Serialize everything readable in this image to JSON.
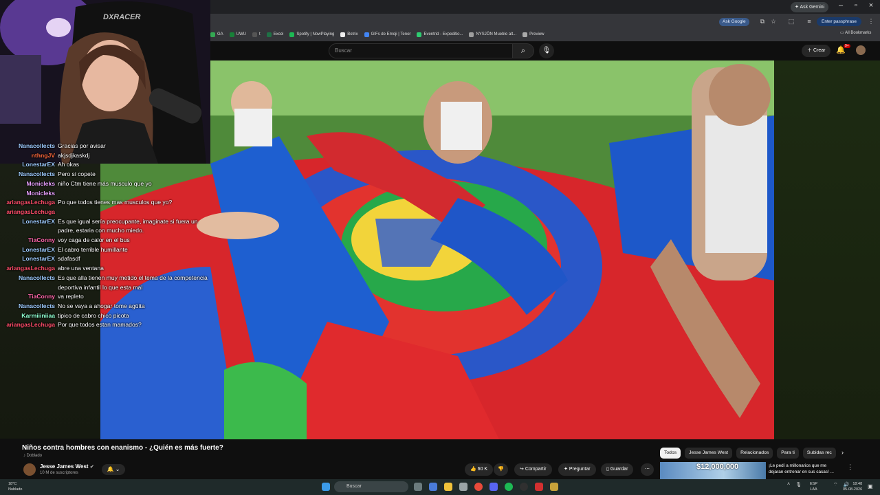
{
  "browser": {
    "gemini_label": "Ask Gemini",
    "ask_google_label": "Ask Google",
    "passphrase_label": "Enter passphrase",
    "all_bookmarks_label": "All Bookmarks",
    "bookmarks": [
      {
        "label": "GA",
        "color": "#34a853"
      },
      {
        "label": "UWU",
        "color": "#188038"
      },
      {
        "label": "t",
        "color": "#555555"
      },
      {
        "label": "Excel",
        "color": "#1e7145"
      },
      {
        "label": "Spotify | NowPlaying",
        "color": "#1db954"
      },
      {
        "label": "Botrix",
        "color": "#eeeeee"
      },
      {
        "label": "GIFs de Emoji | Tenor",
        "color": "#4285f4"
      },
      {
        "label": "Eventrid - Expeditio...",
        "color": "#2ecc71"
      },
      {
        "label": "NYSJÖN Mueble alt...",
        "color": "#9e9e9e"
      },
      {
        "label": "Preview",
        "color": "#aaaaaa"
      }
    ]
  },
  "youtube": {
    "search_placeholder": "Buscar",
    "create_label": "Crear",
    "notification_count": "9+"
  },
  "webcam": {
    "chair_brand": "DXRACER"
  },
  "chat": [
    {
      "user": "Nanacollects",
      "color": "#9ecbff",
      "text": "Gracias por avisar"
    },
    {
      "user": "nthngJV",
      "color": "#ff6a3d",
      "text": "akjsdjkaskdj"
    },
    {
      "user": "LonestarEX",
      "color": "#9ecbff",
      "text": "Ah okas"
    },
    {
      "user": "Nanacollects",
      "color": "#9ecbff",
      "text": "Pero si copete"
    },
    {
      "user": "Monicleks",
      "color": "#e8a0ff",
      "text": "niño Ctm tiene más musculo que yo"
    },
    {
      "user": "Monicleks",
      "color": "#e8a0ff",
      "text": ""
    },
    {
      "user": "ariangasLechuga",
      "color": "#ff4d6a",
      "text": "Po que todos tienes mas musculos que yo?"
    },
    {
      "user": "ariangasLechuga",
      "color": "#ff4d6a",
      "text": ""
    },
    {
      "user": "LonestarEX",
      "color": "#9ecbff",
      "text": "Es que igual sería preocupante, imaginate si fuera un padre, estaria con mucho miedo."
    },
    {
      "user": "TiaConny",
      "color": "#ff66aa",
      "text": "voy caga de calor en el bus"
    },
    {
      "user": "LonestarEX",
      "color": "#9ecbff",
      "text": "El cabro terrible humillante"
    },
    {
      "user": "LonestarEX",
      "color": "#9ecbff",
      "text": "sdafasdf"
    },
    {
      "user": "ariangasLechuga",
      "color": "#ff4d6a",
      "text": "abre una ventana"
    },
    {
      "user": "Nanacollects",
      "color": "#9ecbff",
      "text": "Es que alla tienen muy metido el tema de la competencia deportiva infantil lo que esta mal"
    },
    {
      "user": "TiaConny",
      "color": "#ff66aa",
      "text": "va repleto"
    },
    {
      "user": "Nanacollects",
      "color": "#9ecbff",
      "text": "No se vaya a ahogar tome agüita"
    },
    {
      "user": "Karmiiiniiaa",
      "color": "#8fffd0",
      "text": "tipico de cabro chico picota"
    },
    {
      "user": "ariangasLechuga",
      "color": "#ff4d6a",
      "text": "Por que todos estan mamados?"
    }
  ],
  "video": {
    "title": "Niños contra hombres con enanismo - ¿Quién es más fuerte?",
    "dubbed_label": "Doblado",
    "channel_name": "Jesse James West",
    "subscribers": "10 M de suscriptores",
    "likes": "60 K",
    "share_label": "Compartir",
    "ask_label": "Preguntar",
    "save_label": "Guardar"
  },
  "chips": [
    "Todos",
    "Jesse James West",
    "Relacionados",
    "Para ti",
    "Subidas rec"
  ],
  "recommended": {
    "thumbnail_text": "$12,000,000",
    "title": "¡Le pedí a millonarios que me dejaran entrenar en sus casas! ..."
  },
  "taskbar": {
    "temperature": "18°C",
    "weather": "Nublado",
    "search_placeholder": "Buscar",
    "lang_top": "ESP",
    "lang_bottom": "LAA",
    "time": "18:48",
    "date": "05-08-2026"
  }
}
